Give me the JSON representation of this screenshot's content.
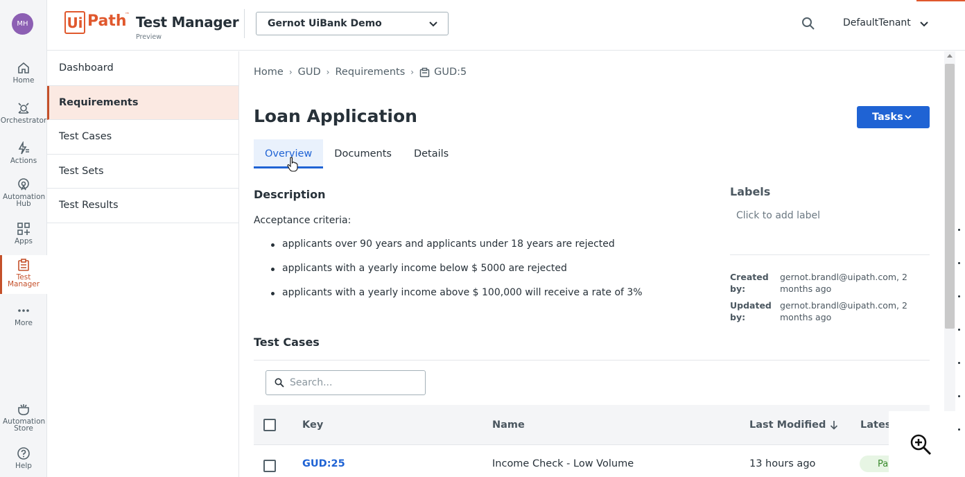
{
  "rail": {
    "avatar": "MH",
    "items": [
      {
        "label": "Home"
      },
      {
        "label": "Orchestrator"
      },
      {
        "label": "Actions"
      },
      {
        "label": "Automation Hub"
      },
      {
        "label": "Apps"
      },
      {
        "label": "Test Manager"
      },
      {
        "label": "More"
      },
      {
        "label": "Automation Store"
      },
      {
        "label": "Help"
      }
    ]
  },
  "header": {
    "logo_ui": "Ui",
    "logo_path": "Path",
    "logo_tm": "™",
    "product": "Test Manager",
    "product_sub": "Preview",
    "project": "Gernot UiBank Demo",
    "tenant": "DefaultTenant"
  },
  "subnav": {
    "items": [
      "Dashboard",
      "Requirements",
      "Test Cases",
      "Test Sets",
      "Test Results"
    ]
  },
  "breadcrumb": {
    "items": [
      "Home",
      "GUD",
      "Requirements"
    ],
    "current": "GUD:5"
  },
  "requirement": {
    "title": "Loan Application",
    "tasks_label": "Tasks",
    "tabs": [
      "Overview",
      "Documents",
      "Details"
    ],
    "description_heading": "Description",
    "description_intro": "Acceptance criteria:",
    "criteria": [
      "applicants over 90 years and applicants under 18 years are rejected",
      "applicants with a yearly income below $ 5000 are rejected",
      "applicants with a yearly income above $ 100,000 will receive a rate of 3%"
    ],
    "labels_heading": "Labels",
    "labels_placeholder": "Click to add label",
    "created_label": "Created by:",
    "created_value": "gernot.brandl@uipath.com, 2 months ago",
    "updated_label": "Updated by:",
    "updated_value": "gernot.brandl@uipath.com, 2 months ago"
  },
  "test_cases": {
    "heading": "Test Cases",
    "search_placeholder": "Search...",
    "columns": {
      "key": "Key",
      "name": "Name",
      "last_modified": "Last Modified",
      "latest": "Latest"
    },
    "rows": [
      {
        "key": "GUD:25",
        "name": "Income Check - Low Volume",
        "last_modified": "13 hours ago",
        "latest": "Pa"
      }
    ]
  },
  "colors": {
    "accent": "#1f63d4",
    "brand": "#e0582d",
    "active_nav": "#c4502a"
  }
}
